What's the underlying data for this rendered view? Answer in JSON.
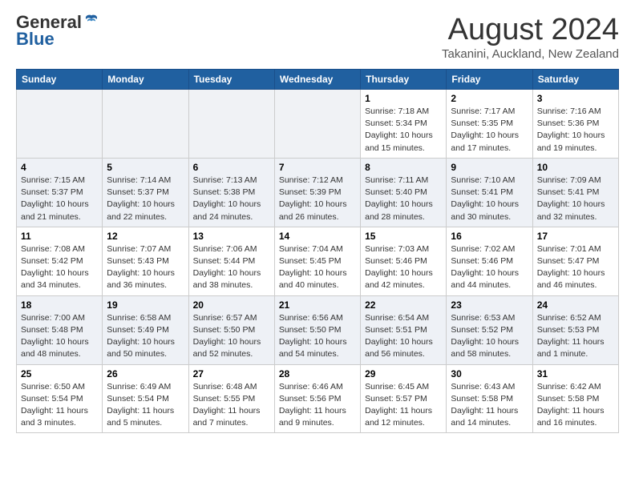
{
  "header": {
    "logo_general": "General",
    "logo_blue": "Blue",
    "month_title": "August 2024",
    "location": "Takanini, Auckland, New Zealand"
  },
  "calendar": {
    "weekdays": [
      "Sunday",
      "Monday",
      "Tuesday",
      "Wednesday",
      "Thursday",
      "Friday",
      "Saturday"
    ],
    "weeks": [
      [
        {
          "day": "",
          "empty": true
        },
        {
          "day": "",
          "empty": true
        },
        {
          "day": "",
          "empty": true
        },
        {
          "day": "",
          "empty": true
        },
        {
          "day": "1",
          "sunrise": "7:18 AM",
          "sunset": "5:34 PM",
          "daylight": "10 hours and 15 minutes."
        },
        {
          "day": "2",
          "sunrise": "7:17 AM",
          "sunset": "5:35 PM",
          "daylight": "10 hours and 17 minutes."
        },
        {
          "day": "3",
          "sunrise": "7:16 AM",
          "sunset": "5:36 PM",
          "daylight": "10 hours and 19 minutes."
        }
      ],
      [
        {
          "day": "4",
          "sunrise": "7:15 AM",
          "sunset": "5:37 PM",
          "daylight": "10 hours and 21 minutes."
        },
        {
          "day": "5",
          "sunrise": "7:14 AM",
          "sunset": "5:37 PM",
          "daylight": "10 hours and 22 minutes."
        },
        {
          "day": "6",
          "sunrise": "7:13 AM",
          "sunset": "5:38 PM",
          "daylight": "10 hours and 24 minutes."
        },
        {
          "day": "7",
          "sunrise": "7:12 AM",
          "sunset": "5:39 PM",
          "daylight": "10 hours and 26 minutes."
        },
        {
          "day": "8",
          "sunrise": "7:11 AM",
          "sunset": "5:40 PM",
          "daylight": "10 hours and 28 minutes."
        },
        {
          "day": "9",
          "sunrise": "7:10 AM",
          "sunset": "5:41 PM",
          "daylight": "10 hours and 30 minutes."
        },
        {
          "day": "10",
          "sunrise": "7:09 AM",
          "sunset": "5:41 PM",
          "daylight": "10 hours and 32 minutes."
        }
      ],
      [
        {
          "day": "11",
          "sunrise": "7:08 AM",
          "sunset": "5:42 PM",
          "daylight": "10 hours and 34 minutes."
        },
        {
          "day": "12",
          "sunrise": "7:07 AM",
          "sunset": "5:43 PM",
          "daylight": "10 hours and 36 minutes."
        },
        {
          "day": "13",
          "sunrise": "7:06 AM",
          "sunset": "5:44 PM",
          "daylight": "10 hours and 38 minutes."
        },
        {
          "day": "14",
          "sunrise": "7:04 AM",
          "sunset": "5:45 PM",
          "daylight": "10 hours and 40 minutes."
        },
        {
          "day": "15",
          "sunrise": "7:03 AM",
          "sunset": "5:46 PM",
          "daylight": "10 hours and 42 minutes."
        },
        {
          "day": "16",
          "sunrise": "7:02 AM",
          "sunset": "5:46 PM",
          "daylight": "10 hours and 44 minutes."
        },
        {
          "day": "17",
          "sunrise": "7:01 AM",
          "sunset": "5:47 PM",
          "daylight": "10 hours and 46 minutes."
        }
      ],
      [
        {
          "day": "18",
          "sunrise": "7:00 AM",
          "sunset": "5:48 PM",
          "daylight": "10 hours and 48 minutes."
        },
        {
          "day": "19",
          "sunrise": "6:58 AM",
          "sunset": "5:49 PM",
          "daylight": "10 hours and 50 minutes."
        },
        {
          "day": "20",
          "sunrise": "6:57 AM",
          "sunset": "5:50 PM",
          "daylight": "10 hours and 52 minutes."
        },
        {
          "day": "21",
          "sunrise": "6:56 AM",
          "sunset": "5:50 PM",
          "daylight": "10 hours and 54 minutes."
        },
        {
          "day": "22",
          "sunrise": "6:54 AM",
          "sunset": "5:51 PM",
          "daylight": "10 hours and 56 minutes."
        },
        {
          "day": "23",
          "sunrise": "6:53 AM",
          "sunset": "5:52 PM",
          "daylight": "10 hours and 58 minutes."
        },
        {
          "day": "24",
          "sunrise": "6:52 AM",
          "sunset": "5:53 PM",
          "daylight": "11 hours and 1 minute."
        }
      ],
      [
        {
          "day": "25",
          "sunrise": "6:50 AM",
          "sunset": "5:54 PM",
          "daylight": "11 hours and 3 minutes."
        },
        {
          "day": "26",
          "sunrise": "6:49 AM",
          "sunset": "5:54 PM",
          "daylight": "11 hours and 5 minutes."
        },
        {
          "day": "27",
          "sunrise": "6:48 AM",
          "sunset": "5:55 PM",
          "daylight": "11 hours and 7 minutes."
        },
        {
          "day": "28",
          "sunrise": "6:46 AM",
          "sunset": "5:56 PM",
          "daylight": "11 hours and 9 minutes."
        },
        {
          "day": "29",
          "sunrise": "6:45 AM",
          "sunset": "5:57 PM",
          "daylight": "11 hours and 12 minutes."
        },
        {
          "day": "30",
          "sunrise": "6:43 AM",
          "sunset": "5:58 PM",
          "daylight": "11 hours and 14 minutes."
        },
        {
          "day": "31",
          "sunrise": "6:42 AM",
          "sunset": "5:58 PM",
          "daylight": "11 hours and 16 minutes."
        }
      ]
    ]
  }
}
